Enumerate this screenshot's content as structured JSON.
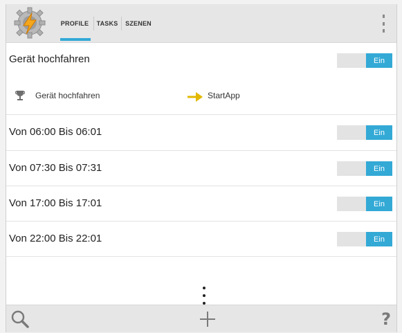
{
  "header": {
    "tabs": [
      {
        "label": "PROFILE",
        "selected": true
      },
      {
        "label": "TASKS",
        "selected": false
      },
      {
        "label": "SZENEN",
        "selected": false
      }
    ],
    "menu_icon": "overflow-menu-icon"
  },
  "profiles": [
    {
      "title": "Gerät hochfahren",
      "toggle_label": "Ein",
      "enabled": true,
      "context": "Gerät hochfahren",
      "task": "StartApp"
    },
    {
      "title": "Von 06:00 Bis 06:01",
      "toggle_label": "Ein",
      "enabled": true
    },
    {
      "title": "Von 07:30 Bis 07:31",
      "toggle_label": "Ein",
      "enabled": true
    },
    {
      "title": "Von 17:00 Bis 17:01",
      "toggle_label": "Ein",
      "enabled": true
    },
    {
      "title": "Von 22:00 Bis 22:01",
      "toggle_label": "Ein",
      "enabled": true
    }
  ],
  "footer": {
    "left_icon": "search-icon",
    "center_icon": "add-icon",
    "right_label": "?"
  },
  "colors": {
    "accent": "#33a9d6",
    "bar_background": "#e6e6e6",
    "arrow": "#e2b800"
  }
}
